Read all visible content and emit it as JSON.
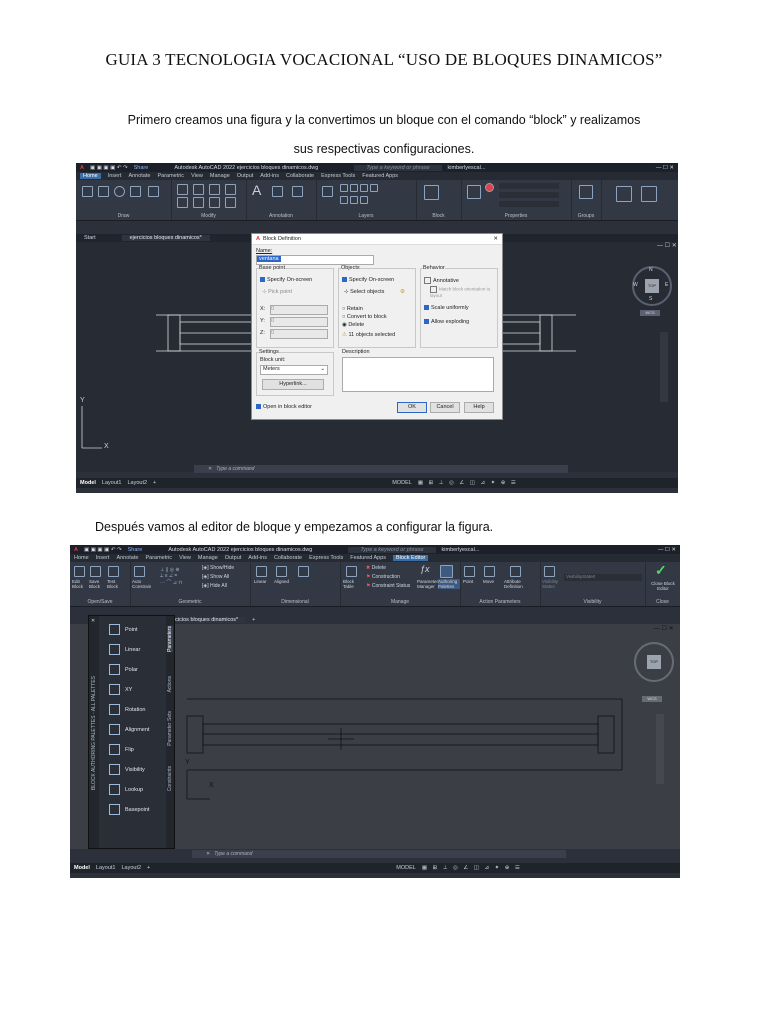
{
  "document": {
    "title": "GUIA 3 TECNOLOGIA VOCACIONAL “USO DE BLOQUES DINAMICOS”",
    "paragraph1_line1": "Primero creamos una figura y la convertimos un bloque con el comando “block” y realizamos",
    "paragraph1_line2": "sus respectivas configuraciones.",
    "paragraph2": "Después vamos al editor de bloque y empezamos a configurar la figura."
  },
  "screenshot1": {
    "window_title": "Autodesk AutoCAD 2022   ejercicios bloques dinamicos.dwg",
    "share": "Share",
    "search_placeholder": "Type a keyword or phrase",
    "user": "kimberlyescal...",
    "menu": [
      "Home",
      "Insert",
      "Annotate",
      "Parametric",
      "View",
      "Manage",
      "Output",
      "Add-ins",
      "Collaborate",
      "Express Tools",
      "Featured Apps"
    ],
    "ribbon_groups": [
      "Draw",
      "Modify",
      "Annotation",
      "Layers",
      "Block",
      "Properties",
      "Groups"
    ],
    "tabs": [
      "Start",
      "ejercicios bloques dinamicos*"
    ],
    "command_placeholder": "Type a command",
    "status_tabs": [
      "Model",
      "Layout1",
      "Layout2"
    ],
    "status_model": "MODEL",
    "viewcube": {
      "top": "TOP",
      "n": "N",
      "s": "S",
      "w": "W",
      "e": "E",
      "wcs": "WCS"
    },
    "dialog": {
      "title": "Block Definition",
      "name_label": "Name:",
      "name_value": "ventana",
      "base_point": "Base point",
      "specify_on_screen": "Specify On-screen",
      "pick_point": "Pick point",
      "x": "X:",
      "y": "Y:",
      "z": "Z:",
      "zero": "0",
      "objects": "Objects",
      "specify_on_screen2": "Specify On-screen",
      "select_objects": "Select objects",
      "retain": "Retain",
      "convert": "Convert to block",
      "delete": "Delete",
      "selected": "11 objects selected",
      "behavior": "Behavior",
      "annotative": "Annotative",
      "match": "Match block orientation to layout",
      "scale": "Scale uniformly",
      "explode": "Allow exploding",
      "settings": "Settings",
      "block_unit": "Block unit:",
      "unit_value": "Meters",
      "hyperlink": "Hyperlink...",
      "description": "Description",
      "open_editor": "Open in block editor",
      "ok": "OK",
      "cancel": "Cancel",
      "help": "Help"
    }
  },
  "screenshot2": {
    "window_title": "Autodesk AutoCAD 2022   ejercicios bloques dinamicos.dwg",
    "share": "Share",
    "search_placeholder": "Type a keyword or phrase",
    "user": "kimberlyescal...",
    "menu": [
      "Home",
      "Insert",
      "Annotate",
      "Parametric",
      "View",
      "Manage",
      "Output",
      "Add-ins",
      "Collaborate",
      "Express Tools",
      "Featured Apps",
      "Block Editor"
    ],
    "ribbon_groups": [
      "Open/Save",
      "Geometric",
      "Dimensional",
      "Manage",
      "Action Parameters",
      "Visibility",
      "Close"
    ],
    "ribbon_buttons": [
      "Edit Block",
      "Save Block",
      "Test Block",
      "Auto Constrain",
      "Show/Hide",
      "Show All",
      "Hide All",
      "Linear",
      "Aligned",
      "Block Table",
      "Delete",
      "Construction",
      "Constraint Status",
      "Parameters Manager",
      "Authoring Palettes",
      "Point",
      "Move",
      "Attribute Definition",
      "Visibility States",
      "VisibilityState0",
      "Close Block Editor"
    ],
    "tab": "ejercicios bloques dinamicos*",
    "palette_items": [
      "Point",
      "Linear",
      "Polar",
      "XY",
      "Rotation",
      "Alignment",
      "Flip",
      "Visibility",
      "Lookup",
      "Basepoint"
    ],
    "palette_side_label": "BLOCK AUTHORING PALETTES - ALL PALETTES",
    "palette_tabs": [
      "Parameters",
      "Actions",
      "Parameter Sets",
      "Constraints"
    ],
    "command_placeholder": "Type a command",
    "status_tabs": [
      "Model",
      "Layout1",
      "Layout2"
    ],
    "status_model": "MODEL",
    "viewcube_top": "TOP",
    "wcs": "WCS"
  }
}
